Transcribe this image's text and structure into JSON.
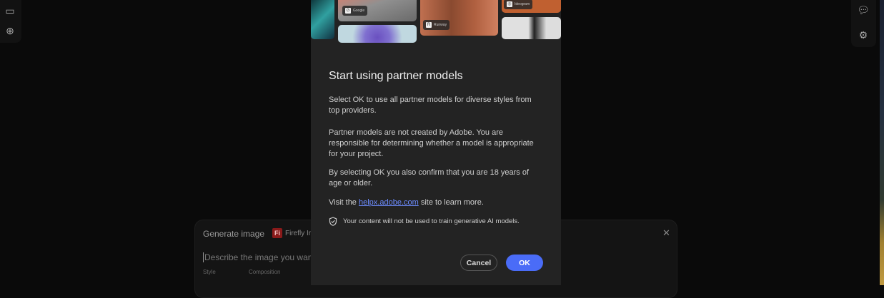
{
  "dialog": {
    "title": "Start using partner models",
    "para1": "Select OK to use all partner models for diverse styles from top providers.",
    "para2": "Partner models are not created by Adobe. You are responsible for determining whether a model is appropriate for your project.",
    "para3": "By selecting OK you also confirm that you are 18 years of age or older.",
    "visit_prefix": "Visit the ",
    "link": "helpx.adobe.com",
    "visit_suffix": " site to learn more.",
    "note": "Your content will not be used to train generative AI models.",
    "cancel": "Cancel",
    "ok": "OK",
    "badges": {
      "google": "Google",
      "runway": "Runway",
      "ideogram": "Ideogram"
    }
  },
  "generate": {
    "title": "Generate image",
    "model_icon": "Fi",
    "model": "Firefly Im",
    "placeholder": "Describe the image you want to",
    "style": "Style",
    "composition": "Composition"
  },
  "colors": {
    "accent": "#4a6cf7",
    "link": "#6c8cff"
  }
}
